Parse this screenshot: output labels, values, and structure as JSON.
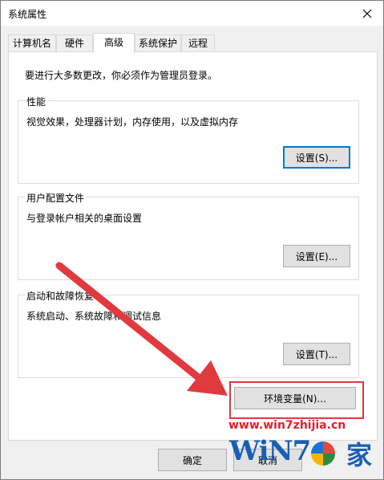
{
  "window": {
    "title": "系统属性"
  },
  "tabs": [
    {
      "label": "计算机名"
    },
    {
      "label": "硬件"
    },
    {
      "label": "高级"
    },
    {
      "label": "系统保护"
    },
    {
      "label": "远程"
    }
  ],
  "active_tab": "高级",
  "intro": "要进行大多数更改，你必须作为管理员登录。",
  "performance": {
    "legend": "性能",
    "description": "视觉效果，处理器计划，内存使用，以及虚拟内存",
    "button": "设置(S)..."
  },
  "user_profiles": {
    "legend": "用户配置文件",
    "description": "与登录帐户相关的桌面设置",
    "button": "设置(E)..."
  },
  "startup_recovery": {
    "legend": "启动和故障恢复",
    "description": "系统启动、系统故障和调试信息",
    "button": "设置(T)..."
  },
  "env_button": "环境变量(N)...",
  "footer": {
    "ok": "确定",
    "cancel": "取消"
  },
  "watermark": {
    "url": "www.win7zhijia.cn",
    "logo_text": "WiN7",
    "logo_char": "家"
  },
  "colors": {
    "highlight": "#e0393e",
    "focus": "#0078d7",
    "arrow": "#e0393e",
    "watermark": "#1a5fb4"
  }
}
